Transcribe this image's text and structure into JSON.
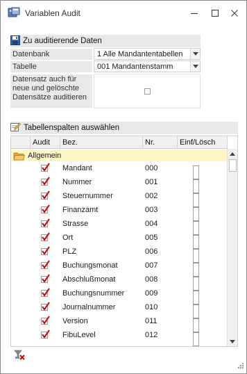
{
  "window": {
    "title": "Variablen Audit"
  },
  "section_data": {
    "title": "Zu auditierende Daten"
  },
  "form": {
    "datenbank_label": "Datenbank",
    "datenbank_value": "1 Alle Mandantentabellen",
    "tabelle_label": "Tabelle",
    "tabelle_value": "001 Mandantenstamm",
    "datensatz_label": "Datensatz auch für neue und gelöschte Datensätze auditieren",
    "datensatz_checked": false
  },
  "section_columns": {
    "title": "Tabellenspalten auswählen"
  },
  "grid": {
    "headers": {
      "audit": "Audit",
      "bez": "Bez.",
      "nr": "Nr.",
      "einf": "Einf/Lösch"
    },
    "group": "Allgemein",
    "rows": [
      {
        "audit": true,
        "bez": "Mandant",
        "nr": "000",
        "einf": false
      },
      {
        "audit": true,
        "bez": "Nummer",
        "nr": "001",
        "einf": false
      },
      {
        "audit": true,
        "bez": "Steuernummer",
        "nr": "002",
        "einf": false
      },
      {
        "audit": true,
        "bez": "Finanzamt",
        "nr": "003",
        "einf": false
      },
      {
        "audit": true,
        "bez": "Strasse",
        "nr": "004",
        "einf": false
      },
      {
        "audit": true,
        "bez": "Ort",
        "nr": "005",
        "einf": false
      },
      {
        "audit": true,
        "bez": "PLZ",
        "nr": "006",
        "einf": false
      },
      {
        "audit": true,
        "bez": "Buchungsmonat",
        "nr": "007",
        "einf": false
      },
      {
        "audit": true,
        "bez": "Abschlußmonat",
        "nr": "008",
        "einf": false
      },
      {
        "audit": true,
        "bez": "Buchungsnummer",
        "nr": "009",
        "einf": false
      },
      {
        "audit": true,
        "bez": "Journalnummer",
        "nr": "010",
        "einf": false
      },
      {
        "audit": true,
        "bez": "Version",
        "nr": "011",
        "einf": false
      },
      {
        "audit": true,
        "bez": "FibuLevel",
        "nr": "012",
        "einf": false
      }
    ]
  },
  "colors": {
    "group_bg": "#fff8c6",
    "check_red": "#d40000",
    "section_bg": "#e8e8e8"
  },
  "icons": {
    "app": "database-audit-icon",
    "save": "save-icon",
    "edit": "edit-icon",
    "folder": "folder-icon",
    "bottom": "clear-filter-icon"
  }
}
